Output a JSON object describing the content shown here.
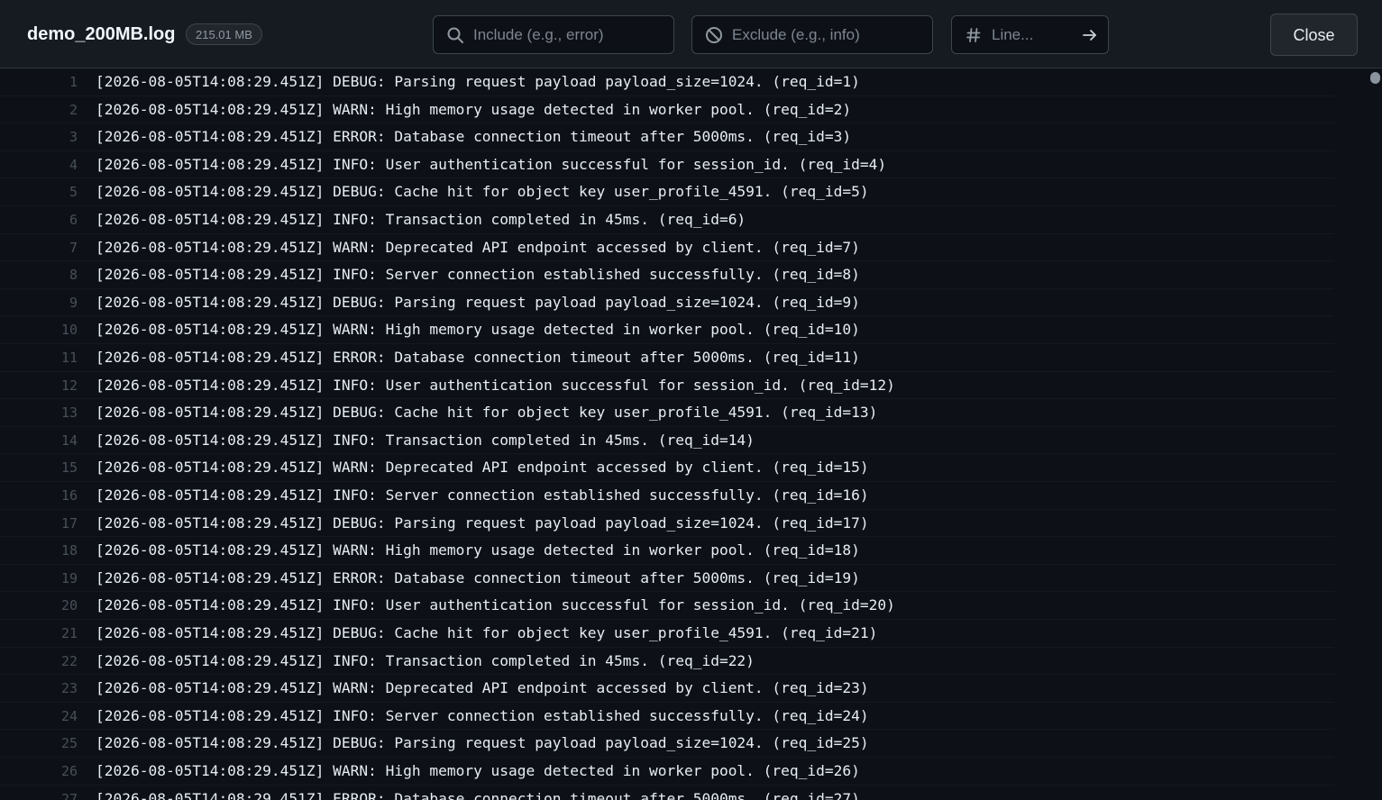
{
  "header": {
    "file_name": "demo_200MB.log",
    "file_size": "215.01 MB",
    "include_placeholder": "Include (e.g., error)",
    "exclude_placeholder": "Exclude (e.g., info)",
    "line_placeholder": "Line...",
    "close_label": "Close"
  },
  "icons": {
    "include": "search-icon",
    "exclude": "block-icon",
    "line": "hash-icon",
    "go": "arrow-right-icon"
  },
  "colors": {
    "background": "#0d1117",
    "toolbar": "#161b22",
    "border": "#30363d",
    "text": "#e6edf3",
    "line_number": "#484f58"
  },
  "log": {
    "lines": [
      {
        "num": "1",
        "text": "[2026-08-05T14:08:29.451Z] DEBUG: Parsing request payload payload_size=1024. (req_id=1)"
      },
      {
        "num": "2",
        "text": "[2026-08-05T14:08:29.451Z] WARN: High memory usage detected in worker pool. (req_id=2)"
      },
      {
        "num": "3",
        "text": "[2026-08-05T14:08:29.451Z] ERROR: Database connection timeout after 5000ms. (req_id=3)"
      },
      {
        "num": "4",
        "text": "[2026-08-05T14:08:29.451Z] INFO: User authentication successful for session_id. (req_id=4)"
      },
      {
        "num": "5",
        "text": "[2026-08-05T14:08:29.451Z] DEBUG: Cache hit for object key user_profile_4591. (req_id=5)"
      },
      {
        "num": "6",
        "text": "[2026-08-05T14:08:29.451Z] INFO: Transaction completed in 45ms. (req_id=6)"
      },
      {
        "num": "7",
        "text": "[2026-08-05T14:08:29.451Z] WARN: Deprecated API endpoint accessed by client. (req_id=7)"
      },
      {
        "num": "8",
        "text": "[2026-08-05T14:08:29.451Z] INFO: Server connection established successfully. (req_id=8)"
      },
      {
        "num": "9",
        "text": "[2026-08-05T14:08:29.451Z] DEBUG: Parsing request payload payload_size=1024. (req_id=9)"
      },
      {
        "num": "10",
        "text": "[2026-08-05T14:08:29.451Z] WARN: High memory usage detected in worker pool. (req_id=10)"
      },
      {
        "num": "11",
        "text": "[2026-08-05T14:08:29.451Z] ERROR: Database connection timeout after 5000ms. (req_id=11)"
      },
      {
        "num": "12",
        "text": "[2026-08-05T14:08:29.451Z] INFO: User authentication successful for session_id. (req_id=12)"
      },
      {
        "num": "13",
        "text": "[2026-08-05T14:08:29.451Z] DEBUG: Cache hit for object key user_profile_4591. (req_id=13)"
      },
      {
        "num": "14",
        "text": "[2026-08-05T14:08:29.451Z] INFO: Transaction completed in 45ms. (req_id=14)"
      },
      {
        "num": "15",
        "text": "[2026-08-05T14:08:29.451Z] WARN: Deprecated API endpoint accessed by client. (req_id=15)"
      },
      {
        "num": "16",
        "text": "[2026-08-05T14:08:29.451Z] INFO: Server connection established successfully. (req_id=16)"
      },
      {
        "num": "17",
        "text": "[2026-08-05T14:08:29.451Z] DEBUG: Parsing request payload payload_size=1024. (req_id=17)"
      },
      {
        "num": "18",
        "text": "[2026-08-05T14:08:29.451Z] WARN: High memory usage detected in worker pool. (req_id=18)"
      },
      {
        "num": "19",
        "text": "[2026-08-05T14:08:29.451Z] ERROR: Database connection timeout after 5000ms. (req_id=19)"
      },
      {
        "num": "20",
        "text": "[2026-08-05T14:08:29.451Z] INFO: User authentication successful for session_id. (req_id=20)"
      },
      {
        "num": "21",
        "text": "[2026-08-05T14:08:29.451Z] DEBUG: Cache hit for object key user_profile_4591. (req_id=21)"
      },
      {
        "num": "22",
        "text": "[2026-08-05T14:08:29.451Z] INFO: Transaction completed in 45ms. (req_id=22)"
      },
      {
        "num": "23",
        "text": "[2026-08-05T14:08:29.451Z] WARN: Deprecated API endpoint accessed by client. (req_id=23)"
      },
      {
        "num": "24",
        "text": "[2026-08-05T14:08:29.451Z] INFO: Server connection established successfully. (req_id=24)"
      },
      {
        "num": "25",
        "text": "[2026-08-05T14:08:29.451Z] DEBUG: Parsing request payload payload_size=1024. (req_id=25)"
      },
      {
        "num": "26",
        "text": "[2026-08-05T14:08:29.451Z] WARN: High memory usage detected in worker pool. (req_id=26)"
      },
      {
        "num": "27",
        "text": "[2026-08-05T14:08:29.451Z] ERROR: Database connection timeout after 5000ms. (req_id=27)"
      }
    ]
  }
}
